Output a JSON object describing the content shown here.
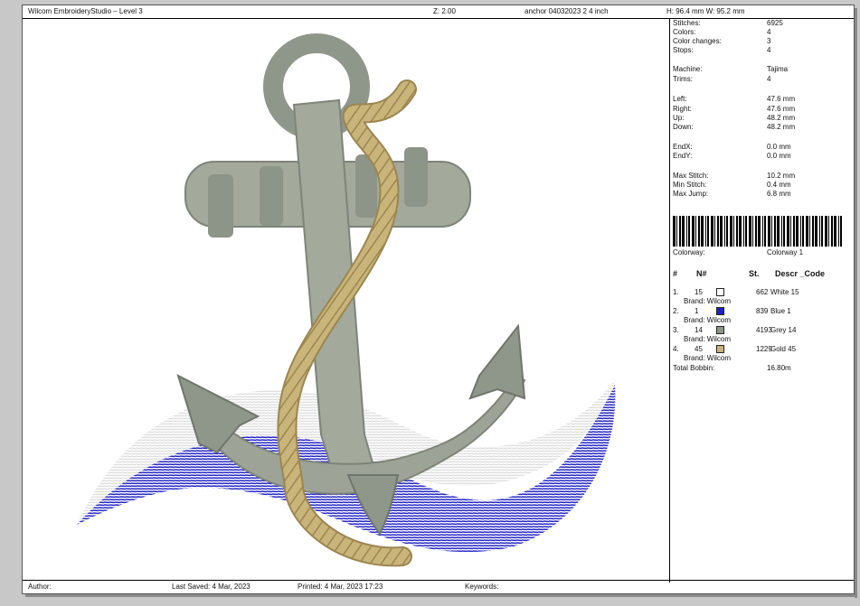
{
  "header": {
    "app_title": "Wilcom EmbroideryStudio – Level 3",
    "zoom": "Z: 2.00",
    "file_name": "anchor 04032023 2 4 inch",
    "size": "H: 96.4 mm   W: 95.2 mm"
  },
  "stats": {
    "stitches_label": "Stitches:",
    "stitches": "6925",
    "colors_label": "Colors:",
    "colors": "4",
    "color_changes_label": "Color changes:",
    "color_changes": "3",
    "stops_label": "Stops:",
    "stops": "4",
    "machine_label": "Machine:",
    "machine": "Tajima",
    "trims_label": "Trims:",
    "trims": "4",
    "left_label": "Left:",
    "left": "47.6 mm",
    "right_label": "Right:",
    "right": "47.6 mm",
    "up_label": "Up:",
    "up": "48.2 mm",
    "down_label": "Down:",
    "down": "48.2 mm",
    "endx_label": "EndX:",
    "endx": "0.0 mm",
    "endy_label": "EndY:",
    "endy": "0.0 mm",
    "max_stitch_label": "Max Stitch:",
    "max_stitch": "10.2 mm",
    "min_stitch_label": "Min Stitch:",
    "min_stitch": "0.4 mm",
    "max_jump_label": "Max Jump:",
    "max_jump": "6.8 mm"
  },
  "colorway": {
    "label": "Colorway:",
    "value": "Colorway 1"
  },
  "color_table": {
    "headers": {
      "num": "#",
      "n": "N#",
      "st": "St.",
      "descr": "Descr _Code"
    },
    "rows": [
      {
        "idx": "1.",
        "n": "15",
        "swatch": "#ffffff",
        "st": "662",
        "descr": "White 15",
        "brand": "Brand: Wilcom"
      },
      {
        "idx": "2.",
        "n": "1",
        "swatch": "#1f1fc8",
        "st": "839",
        "descr": "Blue 1",
        "brand": "Brand: Wilcom"
      },
      {
        "idx": "3.",
        "n": "14",
        "swatch": "#8e958a",
        "st": "4193",
        "descr": "Grey 14",
        "brand": "Brand: Wilcom"
      },
      {
        "idx": "4.",
        "n": "45",
        "swatch": "#c8b27c",
        "st": "1229",
        "descr": "Gold 45",
        "brand": "Brand: Wilcom"
      }
    ],
    "total_label": "Total Bobbin:",
    "total": "16.80m"
  },
  "footer": {
    "author": "Author:",
    "last_saved": "Last Saved:  4 Mar, 2023",
    "printed": "Printed:  4 Mar, 2023 17:23",
    "keywords": "Keywords:"
  },
  "colors": {
    "wave_blue": "#2222c4",
    "wave_white": "#e4e4e4",
    "anchor_grey": "#9da497",
    "rope_gold": "#c9b47a"
  }
}
